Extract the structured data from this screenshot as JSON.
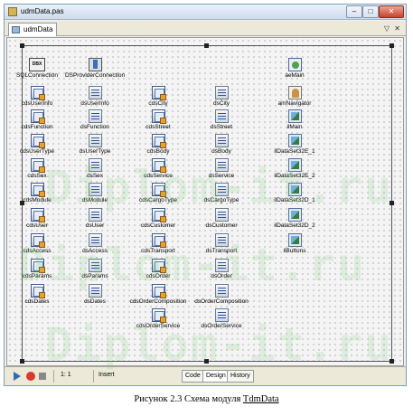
{
  "window": {
    "title": "udmData.pas"
  },
  "tab": {
    "label": "udmData"
  },
  "components": [
    {
      "label": "SQLConnection",
      "icon": "sql-connection-icon",
      "kind": "sql",
      "glyph": "DBX"
    },
    {
      "label": "DSProviderConnection",
      "icon": "ds-provider-connection-icon",
      "kind": "dsp"
    },
    {
      "label": "aeMain",
      "icon": "application-events-icon",
      "kind": "evt"
    },
    {
      "label": "cdsUserInfo",
      "icon": "client-dataset-icon",
      "kind": "cds"
    },
    {
      "label": "dsUserInfo",
      "icon": "datasource-icon",
      "kind": "ds"
    },
    {
      "label": "cdsCity",
      "icon": "client-dataset-icon",
      "kind": "cds"
    },
    {
      "label": "dsCity",
      "icon": "datasource-icon",
      "kind": "ds"
    },
    {
      "label": "amNavigator",
      "icon": "action-manager-icon",
      "kind": "am"
    },
    {
      "label": "cdsFunction",
      "icon": "client-dataset-icon",
      "kind": "cds"
    },
    {
      "label": "dsFunction",
      "icon": "datasource-icon",
      "kind": "ds"
    },
    {
      "label": "cdsStreet",
      "icon": "client-dataset-icon",
      "kind": "cds"
    },
    {
      "label": "dsStreet",
      "icon": "datasource-icon",
      "kind": "ds"
    },
    {
      "label": "ilMain",
      "icon": "image-list-icon",
      "kind": "il"
    },
    {
      "label": "cdsUserType",
      "icon": "client-dataset-icon",
      "kind": "cds"
    },
    {
      "label": "dsUserType",
      "icon": "datasource-icon",
      "kind": "ds"
    },
    {
      "label": "cdsBody",
      "icon": "client-dataset-icon",
      "kind": "cds"
    },
    {
      "label": "dsBody",
      "icon": "datasource-icon",
      "kind": "ds"
    },
    {
      "label": "ilDataSet32E_1",
      "icon": "image-list-icon",
      "kind": "il"
    },
    {
      "label": "cdsSex",
      "icon": "client-dataset-icon",
      "kind": "cds"
    },
    {
      "label": "dsSex",
      "icon": "datasource-icon",
      "kind": "ds"
    },
    {
      "label": "cdsService",
      "icon": "client-dataset-icon",
      "kind": "cds"
    },
    {
      "label": "dsService",
      "icon": "datasource-icon",
      "kind": "ds"
    },
    {
      "label": "ilDataSet32E_2",
      "icon": "image-list-icon",
      "kind": "il"
    },
    {
      "label": "cdsModule",
      "icon": "client-dataset-icon",
      "kind": "cds"
    },
    {
      "label": "dsModule",
      "icon": "datasource-icon",
      "kind": "ds"
    },
    {
      "label": "cdsCargoType",
      "icon": "client-dataset-icon",
      "kind": "cds"
    },
    {
      "label": "dsCargoType",
      "icon": "datasource-icon",
      "kind": "ds"
    },
    {
      "label": "ilDataSet32D_1",
      "icon": "image-list-icon",
      "kind": "il"
    },
    {
      "label": "cdsUser",
      "icon": "client-dataset-icon",
      "kind": "cds"
    },
    {
      "label": "dsUser",
      "icon": "datasource-icon",
      "kind": "ds"
    },
    {
      "label": "cdsCustomer",
      "icon": "client-dataset-icon",
      "kind": "cds"
    },
    {
      "label": "dsCustomer",
      "icon": "datasource-icon",
      "kind": "ds"
    },
    {
      "label": "ilDataSet32D_2",
      "icon": "image-list-icon",
      "kind": "il"
    },
    {
      "label": "cdsAccess",
      "icon": "client-dataset-icon",
      "kind": "cds"
    },
    {
      "label": "dsAccess",
      "icon": "datasource-icon",
      "kind": "ds"
    },
    {
      "label": "cdsTransport",
      "icon": "client-dataset-icon",
      "kind": "cds"
    },
    {
      "label": "dsTransport",
      "icon": "datasource-icon",
      "kind": "ds"
    },
    {
      "label": "ilButtons",
      "icon": "image-list-icon",
      "kind": "il"
    },
    {
      "label": "cdsParams",
      "icon": "client-dataset-icon",
      "kind": "cds"
    },
    {
      "label": "dsParams",
      "icon": "datasource-icon",
      "kind": "ds"
    },
    {
      "label": "cdsOrder",
      "icon": "client-dataset-icon",
      "kind": "cds"
    },
    {
      "label": "dsOrder",
      "icon": "datasource-icon",
      "kind": "ds"
    },
    {
      "label": "cdsDates",
      "icon": "client-dataset-icon",
      "kind": "cds"
    },
    {
      "label": "dsDates",
      "icon": "datasource-icon",
      "kind": "ds"
    },
    {
      "label": "cdsOrderComposition",
      "icon": "client-dataset-icon",
      "kind": "cds"
    },
    {
      "label": "dsOrderComposition",
      "icon": "datasource-icon",
      "kind": "ds"
    },
    {
      "label": "cdsOrderService",
      "icon": "client-dataset-icon",
      "kind": "cds"
    },
    {
      "label": "dsOrderService",
      "icon": "datasource-icon",
      "kind": "ds"
    }
  ],
  "statusbar": {
    "line": "1",
    "col": "1",
    "mode": "Insert",
    "views": [
      "Code",
      "Design",
      "History"
    ],
    "active_view": "Design"
  },
  "watermark": [
    "Diplom-it.ru",
    "Diplom-it.ru",
    "Diplom-it.ru"
  ],
  "caption": {
    "prefix": "Рисунок 2.3 Схема модуля ",
    "name": "TdmData"
  }
}
